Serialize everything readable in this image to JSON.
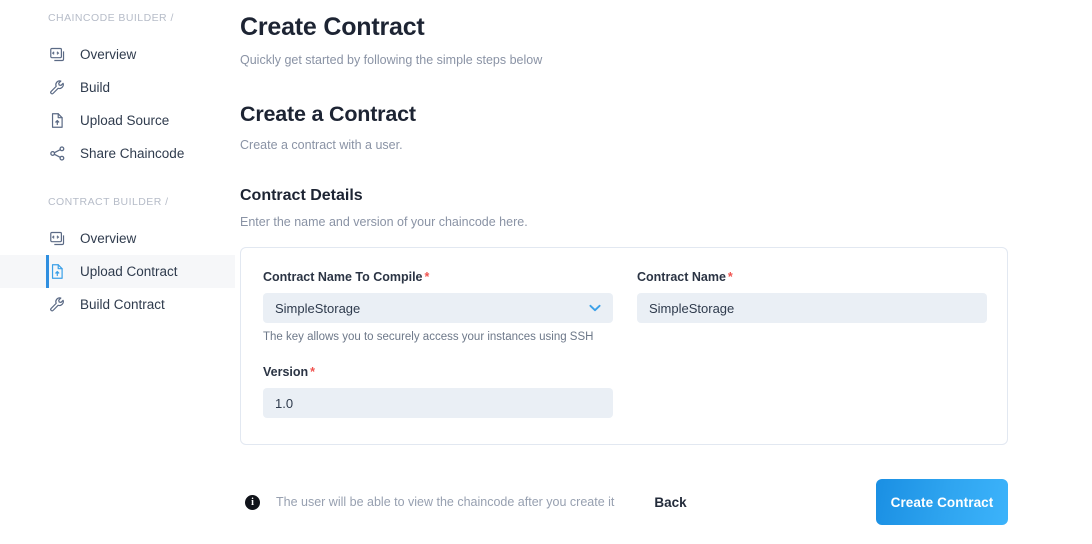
{
  "sidebar": {
    "sections": [
      {
        "title": "CHAINCODE BUILDER /",
        "items": [
          {
            "label": "Overview",
            "icon": "code-window-icon",
            "active": false
          },
          {
            "label": "Build",
            "icon": "wrench-icon",
            "active": false
          },
          {
            "label": "Upload Source",
            "icon": "document-upload-icon",
            "active": false
          },
          {
            "label": "Share Chaincode",
            "icon": "share-nodes-icon",
            "active": false
          }
        ]
      },
      {
        "title": "CONTRACT BUILDER /",
        "items": [
          {
            "label": "Overview",
            "icon": "code-window-icon",
            "active": false
          },
          {
            "label": "Upload Contract",
            "icon": "document-upload-icon",
            "active": true
          },
          {
            "label": "Build Contract",
            "icon": "wrench-icon",
            "active": false
          }
        ]
      }
    ]
  },
  "main": {
    "page_title": "Create Contract",
    "page_subtitle": "Quickly get started by following the simple steps below",
    "section_title": "Create a Contract",
    "section_subtitle": "Create a contract with a user.",
    "details_title": "Contract Details",
    "details_subtitle": "Enter the name and version of your chaincode here."
  },
  "form": {
    "contract_name_to_compile": {
      "label": "Contract Name To Compile",
      "required_mark": "*",
      "value": "SimpleStorage",
      "placeholder": "SimpleStorage",
      "helper": "The key allows you to securely access your instances using SSH",
      "chevron": "chevron-down-icon"
    },
    "contract_name": {
      "label": "Contract Name",
      "required_mark": "*",
      "value": "SimpleStorage",
      "placeholder": "Contract Name"
    },
    "version": {
      "label": "Version",
      "required_mark": "*",
      "value": "1.0",
      "placeholder": "1.0"
    }
  },
  "footer": {
    "info_glyph": "i",
    "info_text": "The user will be able to view the chaincode after you create it",
    "back_label": "Back",
    "primary_label": "Create Contract"
  },
  "colors": {
    "accent": "#3ba0e8",
    "primary_button_start": "#1a8fe3",
    "primary_button_end": "#3cb3fb",
    "required": "#f0534f",
    "input_bg": "#eaeff5",
    "card_border": "#e2e8f1",
    "heading": "#1d2433",
    "muted": "#8a93a5"
  }
}
